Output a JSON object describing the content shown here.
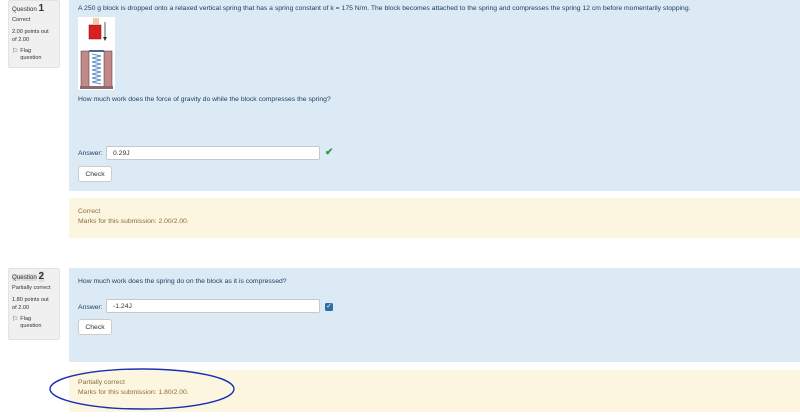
{
  "questions": [
    {
      "label": "Question",
      "number": "1",
      "state": "Correct",
      "grade": "2.00 points out of 2.00",
      "flag_label": "Flag question",
      "text": "A 250 g block is dropped onto a relaxed vertical spring that has a spring constant of k = 175 N/m. The block becomes attached to the spring and compresses the spring 12 cm before momentarily stopping.",
      "prompt": "How much work does the force of gravity do while the block compresses the spring?",
      "answer_label": "Answer:",
      "answer_value": "0.29J",
      "answer_mark": "check-mark-icon",
      "check_label": "Check",
      "feedback": "Correct",
      "marks": "Marks for this submission: 2.00/2.00."
    },
    {
      "label": "Question",
      "number": "2",
      "state": "Partially correct",
      "grade": "1.80 points out of 2.00",
      "flag_label": "Flag question",
      "prompt": "How much work does the spring do on the block as it is compressed?",
      "answer_label": "Answer:",
      "answer_value": "-1.24J",
      "answer_mark": "checkbox-icon",
      "check_label": "Check",
      "feedback": "Partially correct",
      "marks": "Marks for this submission: 1.80/2.00."
    }
  ],
  "colors": {
    "formulation_bg": "#dbeaf5",
    "outcome_bg": "#fcf6e1",
    "correct": "#3a9b3a",
    "annotation": "#1a2fb5"
  }
}
